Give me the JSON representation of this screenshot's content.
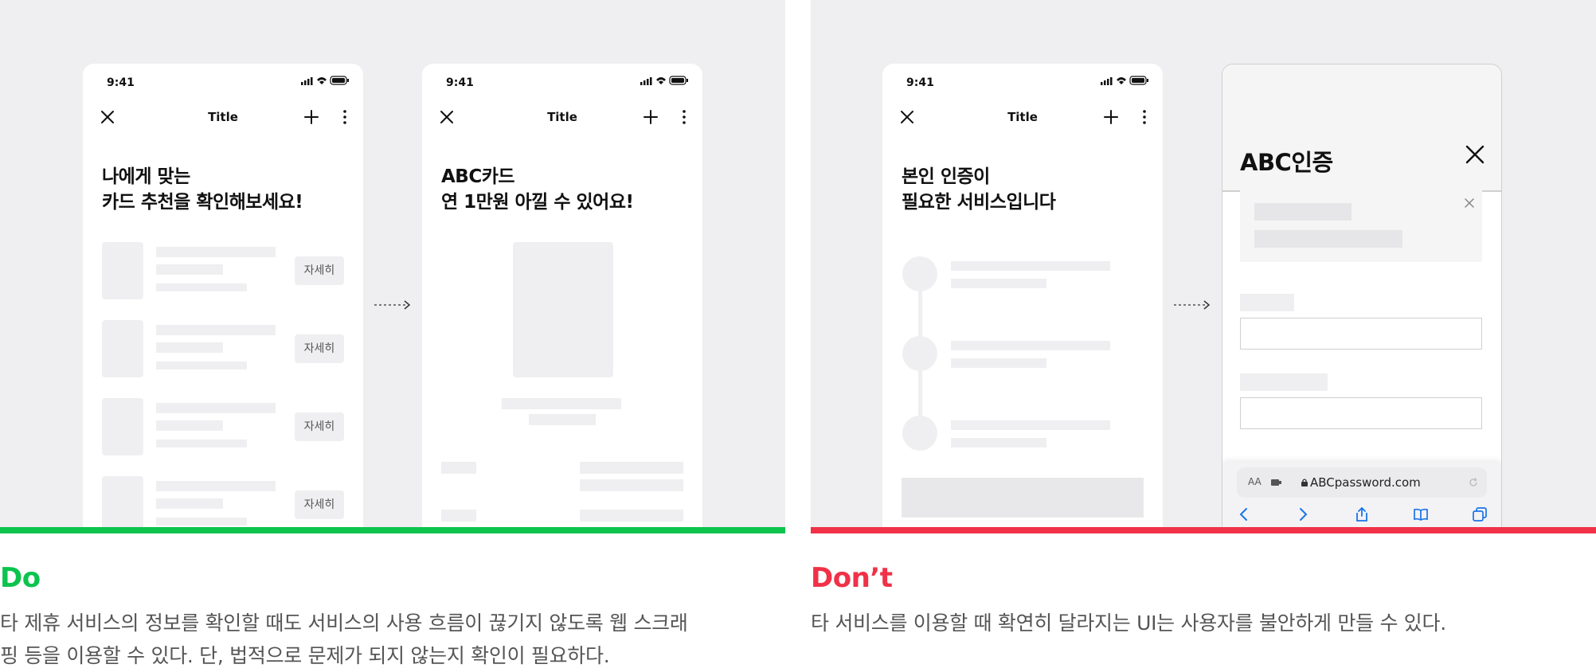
{
  "status": {
    "time": "9:41"
  },
  "do": {
    "heading": "Do",
    "desc_lines": [
      "타 제휴 서비스의 정보를 확인할 때도 서비스의 사용 흐름이 끊기지 않도록 웹 스크래",
      "핑 등을 이용할 수 있다. 단, 법적으로 문제가 되지 않는지 확인이 필요하다."
    ],
    "screen1": {
      "nav_title": "Title",
      "headline": [
        "나에게 맞는",
        "카드 추천을 확인해보세요!"
      ],
      "detail_button": "자세히"
    },
    "screen2": {
      "nav_title": "Title",
      "headline": [
        "ABC카드",
        "연 1만원 아낄 수 있어요!"
      ]
    }
  },
  "dont": {
    "heading": "Don’t",
    "desc_lines": [
      "타 서비스를 이용할 때 확연히 달라지는 UI는 사용자를 불안하게 만들 수 있다."
    ],
    "screen1": {
      "nav_title": "Title",
      "headline": [
        "본인 인증이",
        "필요한 서비스입니다"
      ]
    },
    "screen2": {
      "title": "ABC인증",
      "aa_label": "AA",
      "url": "ABCpassword.com"
    }
  },
  "colors": {
    "do": "#0cc34e",
    "dont": "#f03148",
    "panel_bg": "#efeff1",
    "skeleton": "#efeff1"
  }
}
